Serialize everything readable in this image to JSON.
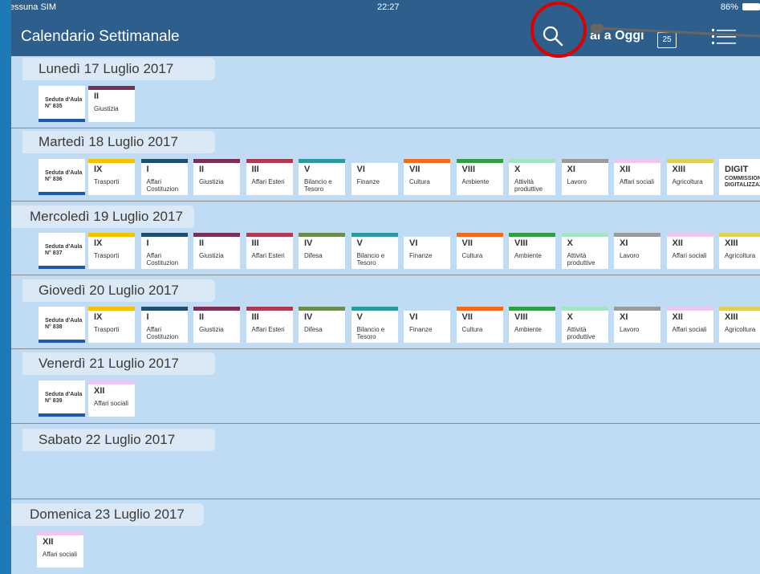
{
  "status": {
    "carrier": "Nessuna SIM",
    "time": "22:27",
    "battery": "86%"
  },
  "nav": {
    "title": "Calendario Settimanale",
    "today": "ai a Oggi",
    "calendar_day": "25"
  },
  "days": [
    {
      "label": "Lunedì 17 Luglio 2017",
      "seduta": "Seduta d'Aula N° 835",
      "cards": [
        {
          "num": "II",
          "label": "Giustizia",
          "color": "#7a2f55"
        }
      ]
    },
    {
      "label": "Martedì 18 Luglio 2017",
      "seduta": "Seduta d'Aula N° 836",
      "cards": [
        {
          "num": "IX",
          "label": "Trasporti",
          "color": "#f5c200"
        },
        {
          "num": "I",
          "label": "Affari Costituzion",
          "color": "#1f4e6e"
        },
        {
          "num": "II",
          "label": "Giustizia",
          "color": "#7a2f55"
        },
        {
          "num": "III",
          "label": "Affari Esteri",
          "color": "#b03a52"
        },
        {
          "num": "V",
          "label": "Bilancio e Tesoro",
          "color": "#2a9a9c"
        },
        {
          "num": "VI",
          "label": "Finanze",
          "color": "#c0dcf5"
        },
        {
          "num": "VII",
          "label": "Cultura",
          "color": "#f26b1d"
        },
        {
          "num": "VIII",
          "label": "Ambiente",
          "color": "#2f9e45"
        },
        {
          "num": "X",
          "label": "Attività produttive",
          "color": "#a7e3c3"
        },
        {
          "num": "XI",
          "label": "Lavoro",
          "color": "#9a9a9a"
        },
        {
          "num": "XII",
          "label": "Affari sociali",
          "color": "#ecc8f0"
        },
        {
          "num": "XIII",
          "label": "Agricoltura",
          "color": "#dfcf53"
        },
        {
          "num": "DIGIT",
          "label": "COMMISSIONE DIGITALIZZAZIONE",
          "color": "#ffffff"
        }
      ]
    },
    {
      "label": "Mercoledì 19 Luglio 2017",
      "seduta": "Seduta d'Aula N° 837",
      "cards": [
        {
          "num": "IX",
          "label": "Trasporti",
          "color": "#f5c200"
        },
        {
          "num": "I",
          "label": "Affari Costituzion",
          "color": "#1f4e6e"
        },
        {
          "num": "II",
          "label": "Giustizia",
          "color": "#7a2f55"
        },
        {
          "num": "III",
          "label": "Affari Esteri",
          "color": "#b03a52"
        },
        {
          "num": "IV",
          "label": "Difesa",
          "color": "#6b8e4e"
        },
        {
          "num": "V",
          "label": "Bilancio e Tesoro",
          "color": "#2a9a9c"
        },
        {
          "num": "VI",
          "label": "Finanze",
          "color": "#c0dcf5"
        },
        {
          "num": "VII",
          "label": "Cultura",
          "color": "#f26b1d"
        },
        {
          "num": "VIII",
          "label": "Ambiente",
          "color": "#2f9e45"
        },
        {
          "num": "X",
          "label": "Attività produttive",
          "color": "#a7e3c3"
        },
        {
          "num": "XI",
          "label": "Lavoro",
          "color": "#9a9a9a"
        },
        {
          "num": "XII",
          "label": "Affari sociali",
          "color": "#ecc8f0"
        },
        {
          "num": "XIII",
          "label": "Agricoltura",
          "color": "#dfcf53"
        }
      ]
    },
    {
      "label": "Giovedì 20 Luglio 2017",
      "seduta": "Seduta d'Aula N° 838",
      "cards": [
        {
          "num": "IX",
          "label": "Trasporti",
          "color": "#f5c200"
        },
        {
          "num": "I",
          "label": "Affari Costituzion",
          "color": "#1f4e6e"
        },
        {
          "num": "II",
          "label": "Giustizia",
          "color": "#7a2f55"
        },
        {
          "num": "III",
          "label": "Affari Esteri",
          "color": "#b03a52"
        },
        {
          "num": "IV",
          "label": "Difesa",
          "color": "#6b8e4e"
        },
        {
          "num": "V",
          "label": "Bilancio e Tesoro",
          "color": "#2a9a9c"
        },
        {
          "num": "VI",
          "label": "Finanze",
          "color": "#c0dcf5"
        },
        {
          "num": "VII",
          "label": "Cultura",
          "color": "#f26b1d"
        },
        {
          "num": "VIII",
          "label": "Ambiente",
          "color": "#2f9e45"
        },
        {
          "num": "X",
          "label": "Attività produttive",
          "color": "#a7e3c3"
        },
        {
          "num": "XI",
          "label": "Lavoro",
          "color": "#9a9a9a"
        },
        {
          "num": "XII",
          "label": "Affari sociali",
          "color": "#ecc8f0"
        },
        {
          "num": "XIII",
          "label": "Agricoltura",
          "color": "#dfcf53"
        }
      ]
    },
    {
      "label": "Venerdì 21 Luglio 2017",
      "seduta": "Seduta d'Aula N° 839",
      "cards": [
        {
          "num": "XII",
          "label": "Affari sociali",
          "color": "#ecc8f0"
        }
      ]
    },
    {
      "label": "Sabato 22 Luglio 2017",
      "seduta": null,
      "cards": []
    },
    {
      "label": "Domenica 23 Luglio 2017",
      "seduta": null,
      "cards": [
        {
          "num": "XII",
          "label": "Affari sociali",
          "color": "#ecc8f0"
        }
      ]
    }
  ]
}
